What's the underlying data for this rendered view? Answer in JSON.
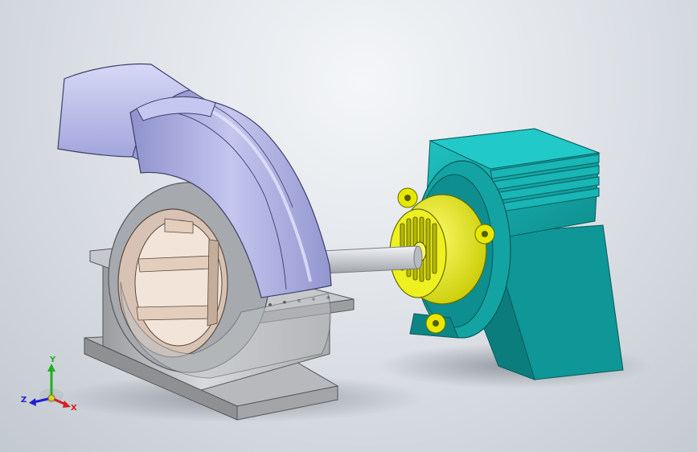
{
  "viewport": {
    "background_top": "#f4f6f8",
    "background_bottom": "#c3c9d1"
  },
  "model": {
    "parts": [
      {
        "name": "volute-casing",
        "color": "#a9acdc"
      },
      {
        "name": "bearing-housing",
        "color": "#c8cace"
      },
      {
        "name": "bearing-ring",
        "color": "#d9c4b4"
      },
      {
        "name": "shaft",
        "color": "#d6d9dd"
      },
      {
        "name": "motor-end-bell",
        "color": "#e8ea10"
      },
      {
        "name": "motor-body",
        "color": "#16a8a8"
      }
    ]
  },
  "triad": {
    "x_label": "X",
    "y_label": "Y",
    "z_label": "Z",
    "x_color": "#d42020",
    "y_color": "#1fb01f",
    "z_color": "#2020d0"
  }
}
